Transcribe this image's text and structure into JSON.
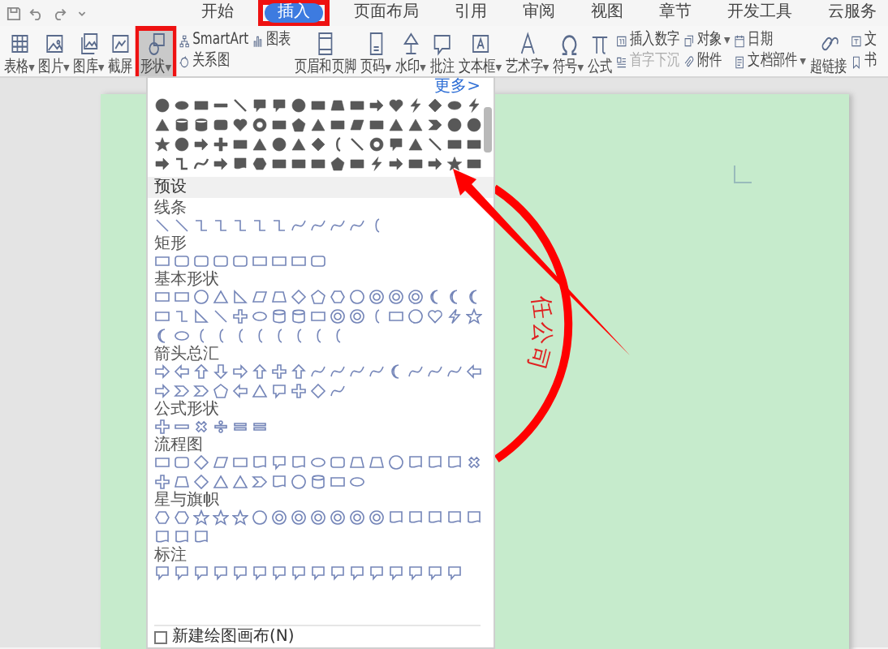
{
  "tabs": [
    {
      "label": "开始",
      "selected": false,
      "highlighted": false
    },
    {
      "label": "插入",
      "selected": true,
      "highlighted": true
    },
    {
      "label": "页面布局",
      "selected": false,
      "highlighted": false
    },
    {
      "label": "引用",
      "selected": false,
      "highlighted": false
    },
    {
      "label": "审阅",
      "selected": false,
      "highlighted": false
    },
    {
      "label": "视图",
      "selected": false,
      "highlighted": false
    },
    {
      "label": "章节",
      "selected": false,
      "highlighted": false
    },
    {
      "label": "开发工具",
      "selected": false,
      "highlighted": false
    },
    {
      "label": "云服务",
      "selected": false,
      "highlighted": false
    }
  ],
  "ribbon": {
    "items": [
      {
        "kind": "large",
        "label": "表格",
        "dropdown": true,
        "pressed": false,
        "highlighted": false
      },
      {
        "kind": "large",
        "label": "图片",
        "dropdown": true,
        "pressed": false,
        "highlighted": false
      },
      {
        "kind": "large",
        "label": "图库",
        "dropdown": true,
        "pressed": false,
        "highlighted": false
      },
      {
        "kind": "large",
        "label": "截屏",
        "dropdown": false,
        "pressed": false,
        "highlighted": false
      },
      {
        "kind": "large",
        "label": "形状",
        "dropdown": true,
        "pressed": true,
        "highlighted": true
      },
      {
        "kind": "stack",
        "buttons": [
          {
            "label": "SmartArt",
            "dropdown": false,
            "disabled": false
          },
          {
            "label": "关系图",
            "dropdown": false,
            "disabled": false
          }
        ]
      },
      {
        "kind": "stack",
        "buttons": [
          {
            "label": "图表",
            "dropdown": false,
            "disabled": false
          }
        ]
      },
      {
        "kind": "large",
        "label": "页眉和页脚",
        "dropdown": false,
        "pressed": false,
        "highlighted": false
      },
      {
        "kind": "large",
        "label": "页码",
        "dropdown": true,
        "pressed": false,
        "highlighted": false
      },
      {
        "kind": "large",
        "label": "水印",
        "dropdown": true,
        "pressed": false,
        "highlighted": false
      },
      {
        "kind": "large",
        "label": "批注",
        "dropdown": false,
        "pressed": false,
        "highlighted": false
      },
      {
        "kind": "large",
        "label": "文本框",
        "dropdown": true,
        "pressed": false,
        "highlighted": false
      },
      {
        "kind": "large",
        "label": "艺术字",
        "dropdown": true,
        "pressed": false,
        "highlighted": false
      },
      {
        "kind": "large",
        "label": "符号",
        "dropdown": true,
        "pressed": false,
        "highlighted": false
      },
      {
        "kind": "large",
        "label": "公式",
        "dropdown": false,
        "pressed": false,
        "highlighted": false
      },
      {
        "kind": "stack",
        "buttons": [
          {
            "label": "插入数字",
            "dropdown": false,
            "disabled": false
          },
          {
            "label": "首字下沉",
            "dropdown": false,
            "disabled": true
          }
        ]
      },
      {
        "kind": "stack",
        "buttons": [
          {
            "label": "对象",
            "dropdown": true,
            "disabled": false
          },
          {
            "label": "附件",
            "dropdown": false,
            "disabled": false
          }
        ]
      },
      {
        "kind": "stack",
        "buttons": [
          {
            "label": "日期",
            "dropdown": false,
            "disabled": false
          },
          {
            "label": "文档部件",
            "dropdown": true,
            "disabled": false
          }
        ]
      },
      {
        "kind": "large",
        "label": "超链接",
        "dropdown": false,
        "pressed": false,
        "highlighted": false
      },
      {
        "kind": "stack",
        "buttons": [
          {
            "label": "文",
            "dropdown": false,
            "disabled": false
          },
          {
            "label": "书",
            "dropdown": false,
            "disabled": false
          }
        ]
      }
    ]
  },
  "stamp": {
    "text": "任公司"
  },
  "shape_panel": {
    "more_link": "更多>",
    "preset_header": "预设",
    "categories": [
      {
        "title": "线条"
      },
      {
        "title": "矩形"
      },
      {
        "title": "基本形状"
      },
      {
        "title": "箭头总汇"
      },
      {
        "title": "公式形状"
      },
      {
        "title": "流程图"
      },
      {
        "title": "星与旗帜"
      },
      {
        "title": "标注"
      }
    ],
    "canvas_option": {
      "label": "新建绘图画布(N)",
      "checked": false
    }
  }
}
